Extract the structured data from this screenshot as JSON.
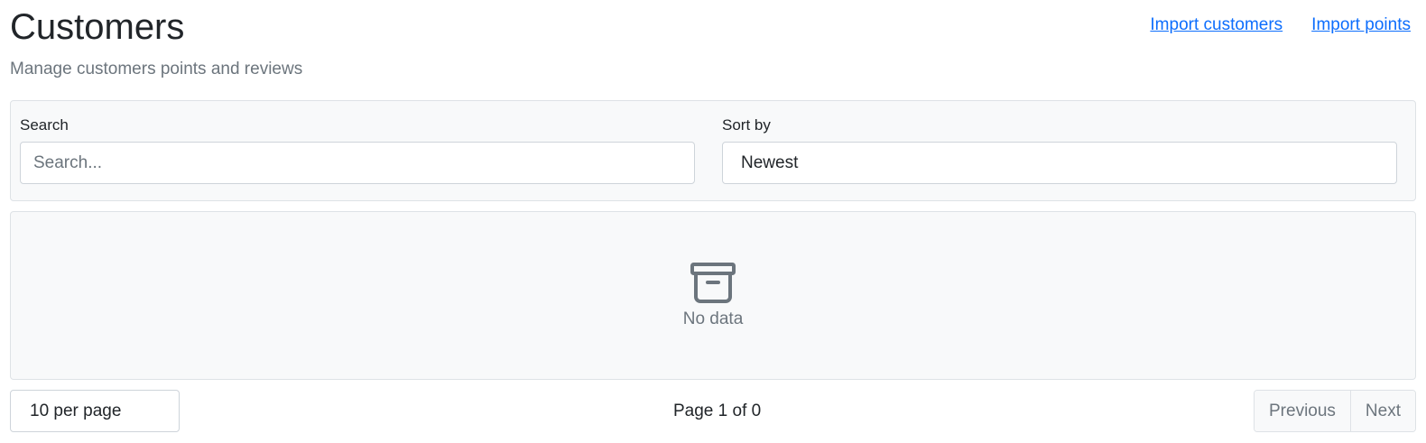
{
  "header": {
    "title": "Customers",
    "subtitle": "Manage customers points and reviews",
    "links": {
      "import_customers": "Import customers",
      "import_points": "Import points"
    }
  },
  "filters": {
    "search_label": "Search",
    "search_placeholder": "Search...",
    "search_value": "",
    "sort_label": "Sort by",
    "sort_value": "Newest"
  },
  "table": {
    "empty_icon": "archive-box-icon",
    "empty_text": "No data"
  },
  "pagination": {
    "per_page": "10 per page",
    "page_info": "Page 1 of 0",
    "previous_label": "Previous",
    "next_label": "Next"
  },
  "colors": {
    "link": "#0d6efd",
    "muted": "#6c757d",
    "panel_bg": "#f8f9fa",
    "border": "#dee2e6"
  }
}
